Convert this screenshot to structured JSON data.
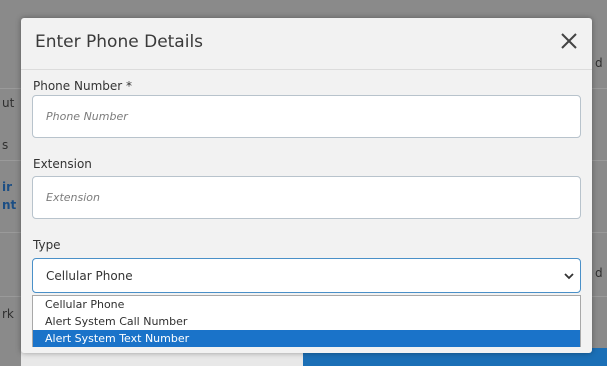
{
  "background": {
    "fragments": [
      "ut",
      "s",
      "ir",
      "nt",
      "rk",
      "d",
      "d"
    ]
  },
  "dialog": {
    "title": "Enter Phone Details",
    "close_icon": "close-icon",
    "fields": {
      "phone_number": {
        "label": "Phone Number *",
        "placeholder": "Phone Number",
        "value": ""
      },
      "extension": {
        "label": "Extension",
        "placeholder": "Extension",
        "value": ""
      },
      "type": {
        "label": "Type",
        "selected": "Cellular Phone",
        "options": [
          "Cellular Phone",
          "Alert System Call Number",
          "Alert System Text Number"
        ],
        "highlighted_option": "Alert System Text Number"
      }
    }
  },
  "colors": {
    "highlight": "#1a73c9",
    "input_border": "#b8c3cc",
    "focus_border": "#4a90c8"
  }
}
